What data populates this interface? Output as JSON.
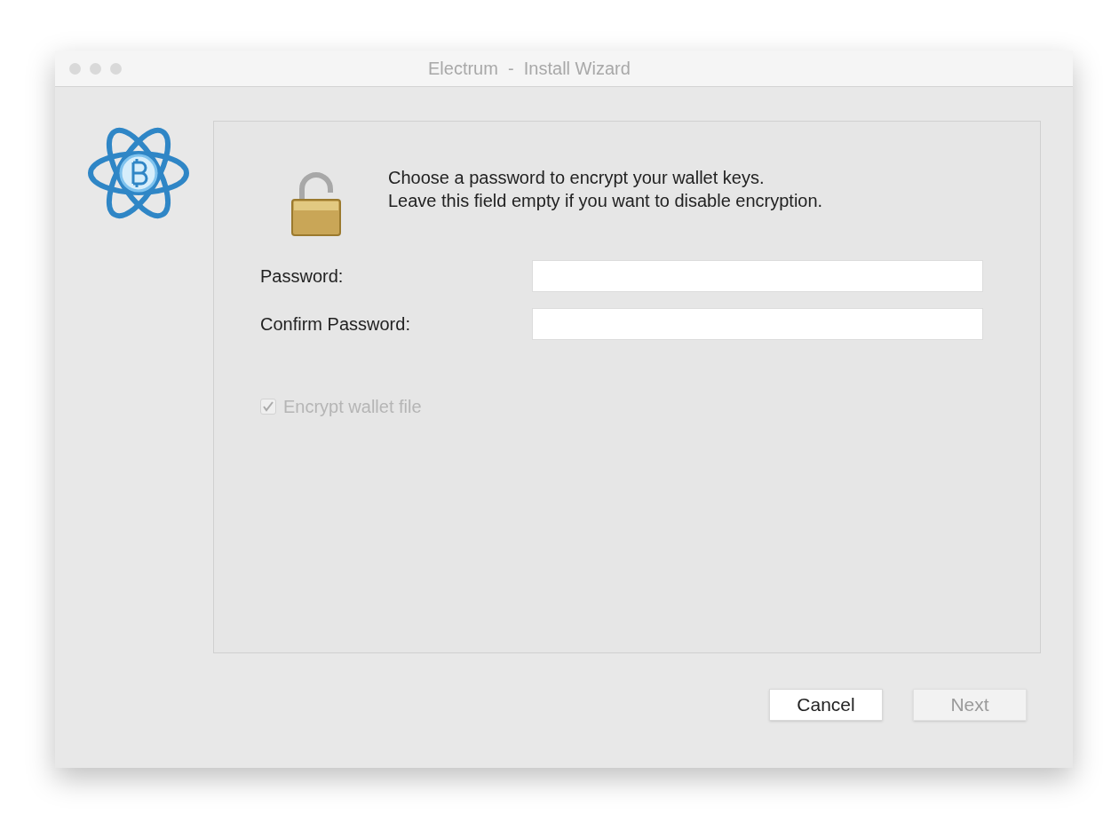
{
  "window": {
    "title": "Electrum  -  Install Wizard"
  },
  "message": [
    "Choose a password to encrypt your wallet keys.",
    "Leave this field empty if you want to disable encryption."
  ],
  "fields": [
    {
      "label": "Password:"
    },
    {
      "label": "Confirm Password:"
    }
  ],
  "checkbox": {
    "label": "Encrypt wallet file",
    "checked": true,
    "disabled": true
  },
  "buttons": [
    {
      "label": "Cancel",
      "disabled": false
    },
    {
      "label": "Next",
      "disabled": true
    }
  ]
}
